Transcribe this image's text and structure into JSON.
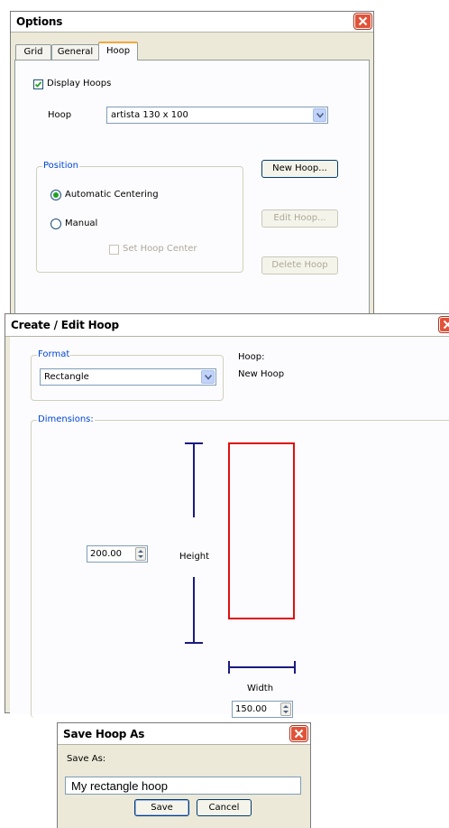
{
  "options_dialog": {
    "title": "Options",
    "tabs": [
      {
        "label": "Grid"
      },
      {
        "label": "General"
      },
      {
        "label": "Hoop"
      }
    ],
    "display_hoops_label": "Display Hoops",
    "display_hoops_checked": true,
    "hoop_label": "Hoop",
    "hoop_value": "artista 130 x 100",
    "position_legend": "Position",
    "automatic_centering_label": "Automatic Centering",
    "manual_label": "Manual",
    "set_hoop_center_label": "Set Hoop Center",
    "new_hoop_button": "New Hoop...",
    "edit_hoop_button": "Edit Hoop...",
    "delete_hoop_button": "Delete Hoop"
  },
  "create_edit_dialog": {
    "title": "Create / Edit Hoop",
    "format_legend": "Format",
    "format_value": "Rectangle",
    "hoop_label": "Hoop:",
    "hoop_name": "New Hoop",
    "dimensions_legend": "Dimensions:",
    "height_value": "200.00",
    "height_label": "Height",
    "width_label": "Width",
    "width_value": "150.00",
    "colors": {
      "hoop_outline": "#e01010",
      "dimension_lines": "#1a1a80"
    }
  },
  "save_dialog": {
    "title": "Save Hoop As",
    "save_as_label": "Save As:",
    "name_value": "My rectangle hoop",
    "save_button": "Save",
    "cancel_button": "Cancel"
  }
}
